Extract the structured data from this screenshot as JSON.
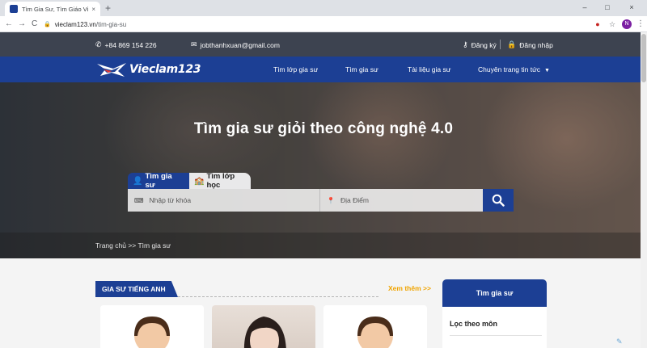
{
  "browser": {
    "tab_title": "Tìm Gia Sư, Tìm Giáo Viên Dạy K",
    "tab_close": "×",
    "new_tab": "+",
    "window_min": "–",
    "window_max": "□",
    "window_close": "×",
    "back": "←",
    "forward": "→",
    "reload": "C",
    "url_host": "vieclam123.vn",
    "url_path": "/tim-gia-su",
    "avatar_letter": "N",
    "menu": "⋮",
    "star": "☆"
  },
  "topbar": {
    "phone": "+84 869 154 226",
    "email": "jobthanhxuan@gmail.com",
    "register": "Đăng ký",
    "login": "Đăng nhập"
  },
  "nav": {
    "logo_text": "Vieclam123",
    "items": [
      {
        "label": "Tìm lớp gia sư"
      },
      {
        "label": "Tìm gia sư"
      },
      {
        "label": "Tài liệu gia sư"
      },
      {
        "label": "Chuyên trang tin tức"
      }
    ],
    "caret": "▼"
  },
  "hero": {
    "title": "Tìm gia sư giỏi theo công nghệ 4.0",
    "tabs": [
      {
        "label": "Tìm gia sư"
      },
      {
        "label": "Tìm lớp học"
      }
    ],
    "keyword_placeholder": "Nhập từ khóa",
    "location_placeholder": "Địa Điểm",
    "breadcrumb": "Trang chủ >> Tìm gia sư"
  },
  "content": {
    "section_title": "GIA SƯ TIẾNG ANH",
    "see_more": "Xem thêm >>",
    "sidebar_title": "Tìm gia sư",
    "sidebar_item": "Lọc theo môn"
  },
  "colors": {
    "primary": "#1c3f94",
    "topbar": "#3d4350",
    "accent": "#f0a400"
  }
}
